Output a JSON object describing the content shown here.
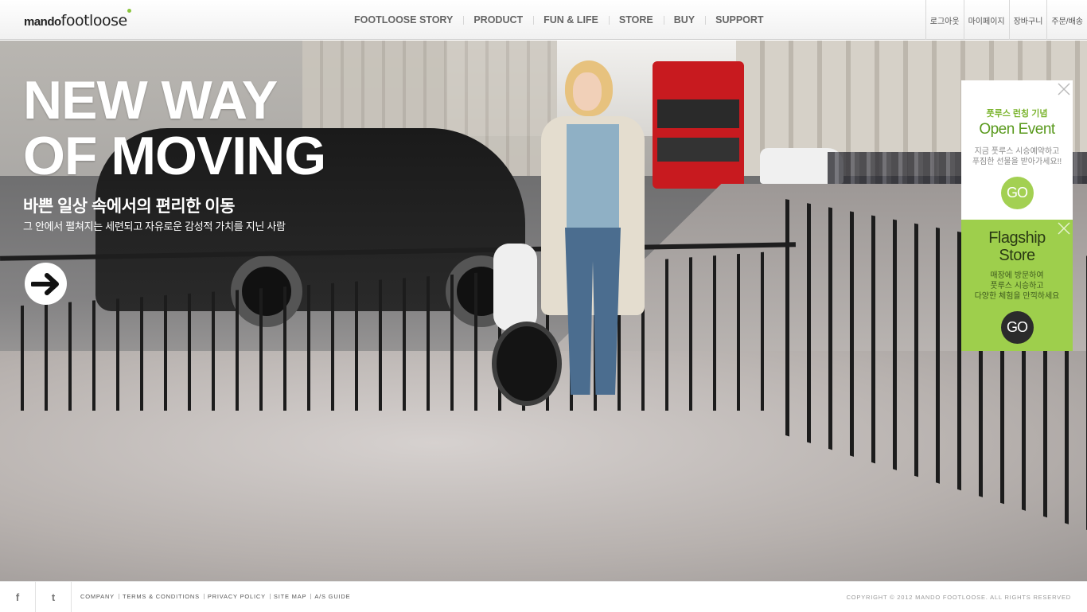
{
  "header": {
    "logo": {
      "bold": "mando",
      "light": "footloose"
    },
    "nav": [
      {
        "label": "FOOTLOOSE  STORY"
      },
      {
        "label": "PRODUCT"
      },
      {
        "label": "FUN & LIFE"
      },
      {
        "label": "STORE"
      },
      {
        "label": "BUY"
      },
      {
        "label": "SUPPORT"
      }
    ],
    "util": [
      {
        "label": "로그아웃"
      },
      {
        "label": "마이페이지"
      },
      {
        "label": "장바구니"
      },
      {
        "label": "주문/배송"
      }
    ]
  },
  "hero": {
    "title_line1": "NEW WAY",
    "title_line2": "OF MOVING",
    "sub1": "바쁜 일상 속에서의 편리한 이동",
    "sub2": "그 안에서 펼쳐지는 세련되고 자유로운 감성적 가치를 지닌 사람",
    "arrow_icon": "arrow-right-icon"
  },
  "banners": {
    "event": {
      "kicker": "풋루스 런칭 기념",
      "title": "Open Event",
      "desc1": "지금 풋루스 시승예약하고",
      "desc2": "푸짐한 선물을 받아가세요!!",
      "go": "GO"
    },
    "store": {
      "title1": "Flagship",
      "title2": "Store",
      "desc1": "매장에 방문하여",
      "desc2": "풋루스 시승하고",
      "desc3": "다양한 체험을 만끽하세요",
      "go": "GO"
    }
  },
  "footer": {
    "sns": [
      {
        "icon": "facebook-icon",
        "glyph": "f"
      },
      {
        "icon": "twitter-icon",
        "glyph": "t"
      }
    ],
    "links": [
      {
        "label": "COMPANY"
      },
      {
        "label": "TERMS & CONDITIONS"
      },
      {
        "label": "PRIVACY POLICY"
      },
      {
        "label": "SITE MAP"
      },
      {
        "label": "A/S GUIDE"
      }
    ],
    "copyright": "COPYRIGHT © 2012 MANDO FOOTLOOSE. ALL RIGHTS RESERVED"
  },
  "colors": {
    "accent_green": "#9ecf4c",
    "dark": "#2b2b2b"
  }
}
